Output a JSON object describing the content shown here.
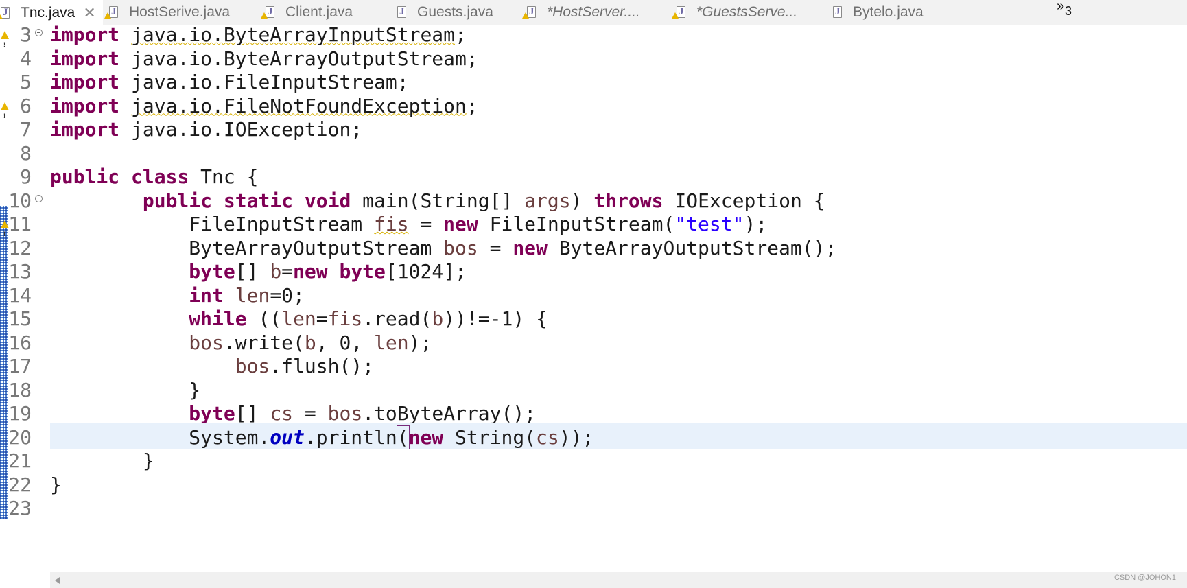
{
  "tabs": [
    {
      "label": "Tnc.java",
      "active": true,
      "dirty": false,
      "warning": true,
      "closable": true
    },
    {
      "label": "HostSerive.java",
      "active": false,
      "dirty": false,
      "warning": true
    },
    {
      "label": "Client.java",
      "active": false,
      "dirty": false,
      "warning": true
    },
    {
      "label": "Guests.java",
      "active": false,
      "dirty": false,
      "warning": false
    },
    {
      "label": "*HostServer....",
      "active": false,
      "dirty": true,
      "warning": true
    },
    {
      "label": "*GuestsServe...",
      "active": false,
      "dirty": true,
      "warning": true
    },
    {
      "label": "Bytelo.java",
      "active": false,
      "dirty": false,
      "warning": false
    }
  ],
  "overflow": {
    "icon": "chevron-double-right-icon",
    "count": "3"
  },
  "editor": {
    "current_line": "20",
    "lines": [
      {
        "n": "3",
        "fold": true,
        "warning": true,
        "tokens": [
          {
            "t": "import",
            "c": "kw"
          },
          {
            "t": " "
          },
          {
            "t": "java.io.ByteArrayInputStream",
            "c": "warnul"
          },
          {
            "t": ";"
          }
        ]
      },
      {
        "n": "4",
        "tokens": [
          {
            "t": "import",
            "c": "kw"
          },
          {
            "t": " java.io.ByteArrayOutputStream;"
          }
        ]
      },
      {
        "n": "5",
        "tokens": [
          {
            "t": "import",
            "c": "kw"
          },
          {
            "t": " java.io.FileInputStream;"
          }
        ]
      },
      {
        "n": "6",
        "warning": true,
        "tokens": [
          {
            "t": "import",
            "c": "kw"
          },
          {
            "t": " "
          },
          {
            "t": "java.io.FileNotFoundException",
            "c": "warnul"
          },
          {
            "t": ";"
          }
        ]
      },
      {
        "n": "7",
        "tokens": [
          {
            "t": "import",
            "c": "kw"
          },
          {
            "t": " java.io.IOException;"
          }
        ]
      },
      {
        "n": "8",
        "tokens": []
      },
      {
        "n": "9",
        "tokens": [
          {
            "t": "public",
            "c": "kw"
          },
          {
            "t": " "
          },
          {
            "t": "class",
            "c": "kw"
          },
          {
            "t": " Tnc {"
          }
        ]
      },
      {
        "n": "10",
        "fold": true,
        "tokens": [
          {
            "t": "        "
          },
          {
            "t": "public",
            "c": "kw"
          },
          {
            "t": " "
          },
          {
            "t": "static",
            "c": "kw"
          },
          {
            "t": " "
          },
          {
            "t": "void",
            "c": "kw"
          },
          {
            "t": " main(String[] "
          },
          {
            "t": "args",
            "c": "var"
          },
          {
            "t": ") "
          },
          {
            "t": "throws",
            "c": "kw"
          },
          {
            "t": " IOException {"
          }
        ]
      },
      {
        "n": "11",
        "warning": true,
        "tokens": [
          {
            "t": "            FileInputStream "
          },
          {
            "t": "fis",
            "c": "var warnul"
          },
          {
            "t": " = "
          },
          {
            "t": "new",
            "c": "kw"
          },
          {
            "t": " FileInputStream("
          },
          {
            "t": "\"test\"",
            "c": "str"
          },
          {
            "t": ");"
          }
        ]
      },
      {
        "n": "12",
        "tokens": [
          {
            "t": "            ByteArrayOutputStream "
          },
          {
            "t": "bos",
            "c": "var"
          },
          {
            "t": " = "
          },
          {
            "t": "new",
            "c": "kw"
          },
          {
            "t": " ByteArrayOutputStream();"
          }
        ]
      },
      {
        "n": "13",
        "tokens": [
          {
            "t": "            "
          },
          {
            "t": "byte",
            "c": "kw"
          },
          {
            "t": "[] "
          },
          {
            "t": "b",
            "c": "var"
          },
          {
            "t": "="
          },
          {
            "t": "new",
            "c": "kw"
          },
          {
            "t": " "
          },
          {
            "t": "byte",
            "c": "kw"
          },
          {
            "t": "[1024];"
          }
        ]
      },
      {
        "n": "14",
        "tokens": [
          {
            "t": "            "
          },
          {
            "t": "int",
            "c": "kw"
          },
          {
            "t": " "
          },
          {
            "t": "len",
            "c": "var"
          },
          {
            "t": "=0;"
          }
        ]
      },
      {
        "n": "15",
        "tokens": [
          {
            "t": "            "
          },
          {
            "t": "while",
            "c": "kw"
          },
          {
            "t": " (("
          },
          {
            "t": "len",
            "c": "var"
          },
          {
            "t": "="
          },
          {
            "t": "fis",
            "c": "var"
          },
          {
            "t": ".read("
          },
          {
            "t": "b",
            "c": "var"
          },
          {
            "t": "))!=-1) {"
          }
        ]
      },
      {
        "n": "16",
        "tokens": [
          {
            "t": "            "
          },
          {
            "t": "bos",
            "c": "var"
          },
          {
            "t": ".write("
          },
          {
            "t": "b",
            "c": "var"
          },
          {
            "t": ", 0, "
          },
          {
            "t": "len",
            "c": "var"
          },
          {
            "t": ");"
          }
        ]
      },
      {
        "n": "17",
        "tokens": [
          {
            "t": "                "
          },
          {
            "t": "bos",
            "c": "var"
          },
          {
            "t": ".flush();"
          }
        ]
      },
      {
        "n": "18",
        "tokens": [
          {
            "t": "            }"
          }
        ]
      },
      {
        "n": "19",
        "tokens": [
          {
            "t": "            "
          },
          {
            "t": "byte",
            "c": "kw"
          },
          {
            "t": "[] "
          },
          {
            "t": "cs",
            "c": "var"
          },
          {
            "t": " = "
          },
          {
            "t": "bos",
            "c": "var"
          },
          {
            "t": ".toByteArray();"
          }
        ]
      },
      {
        "n": "20",
        "tokens": [
          {
            "t": "            System."
          },
          {
            "t": "out",
            "c": "fld"
          },
          {
            "t": ".println"
          },
          {
            "t": "(",
            "c": "bracket"
          },
          {
            "t": "new",
            "c": "kw"
          },
          {
            "t": " String("
          },
          {
            "t": "cs",
            "c": "var"
          },
          {
            "t": "));"
          }
        ]
      },
      {
        "n": "21",
        "tokens": [
          {
            "t": "        }"
          }
        ]
      },
      {
        "n": "22",
        "tokens": [
          {
            "t": "}"
          }
        ]
      },
      {
        "n": "23",
        "tokens": []
      }
    ]
  },
  "watermark": "CSDN @JOHON1"
}
